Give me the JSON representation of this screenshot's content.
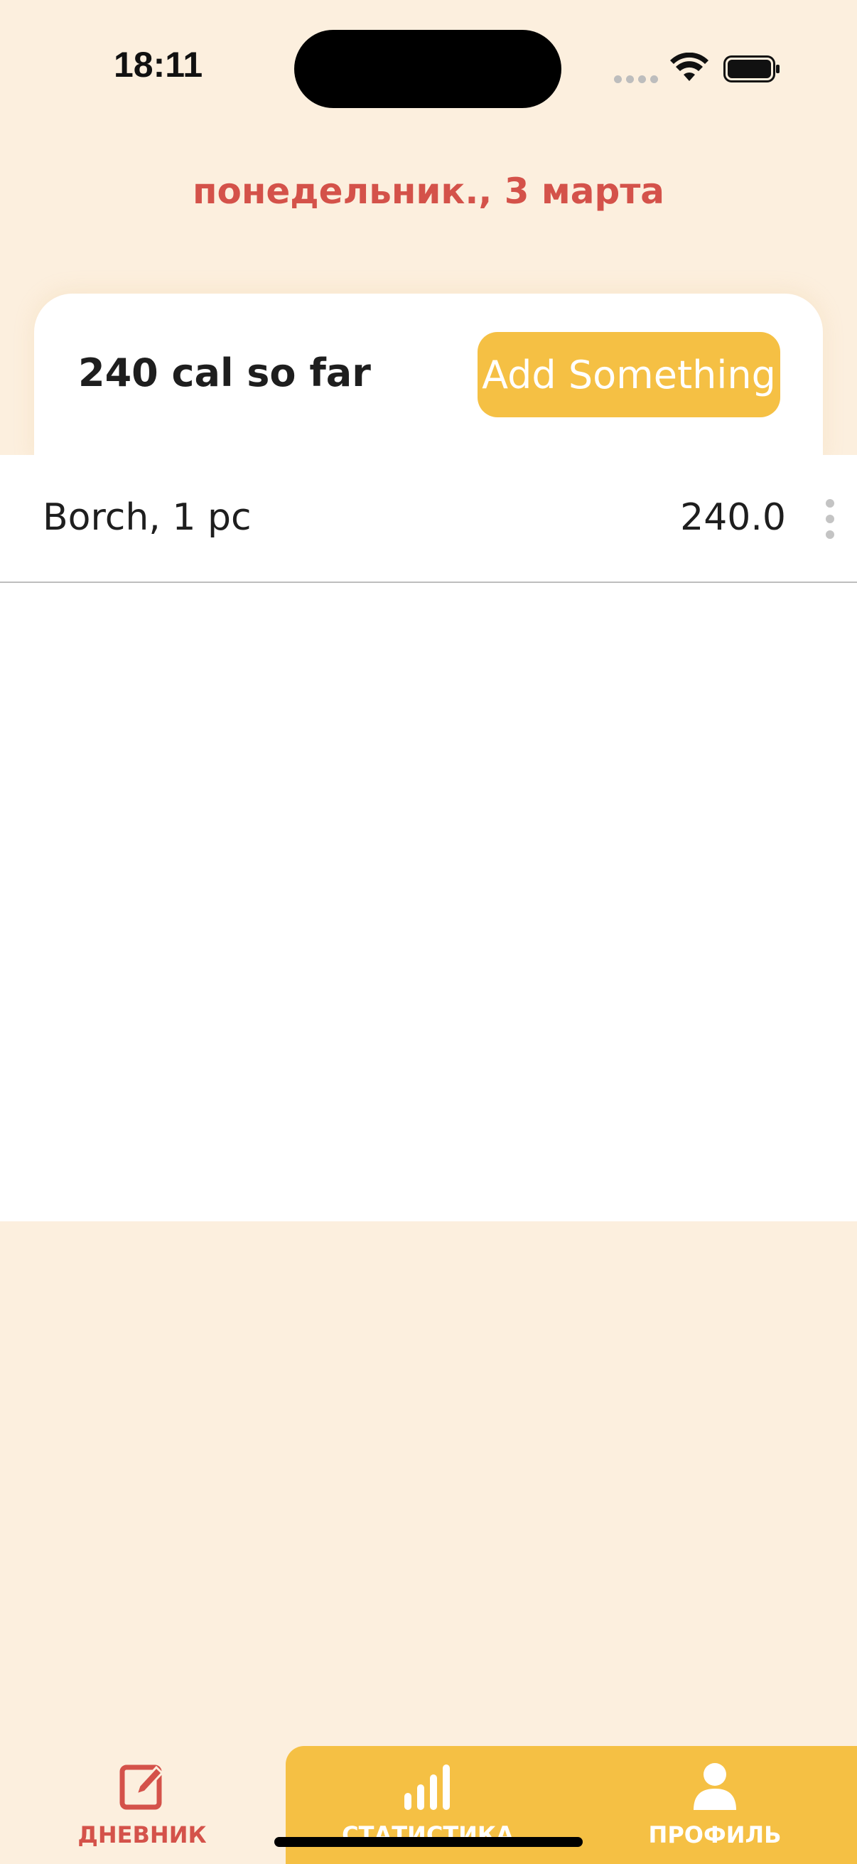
{
  "status_bar": {
    "time": "18:11"
  },
  "header": {
    "date": "понедельник., 3 марта"
  },
  "summary": {
    "text": "240 cal so far",
    "add_button_label": "Add Something"
  },
  "entries": [
    {
      "name": "Borch, 1 pc",
      "calories": "240.0"
    }
  ],
  "tab_bar": {
    "tabs": [
      {
        "label": "ДНЕВНИК",
        "icon": "edit-icon",
        "active": true
      },
      {
        "label": "СТАТИСТИКА",
        "icon": "bar-chart-icon",
        "active": false
      },
      {
        "label": "ПРОФИЛЬ",
        "icon": "person-icon",
        "active": false
      }
    ]
  },
  "colors": {
    "background": "#FCEFDE",
    "accent": "#F5C044",
    "date_red": "#D4524A"
  }
}
